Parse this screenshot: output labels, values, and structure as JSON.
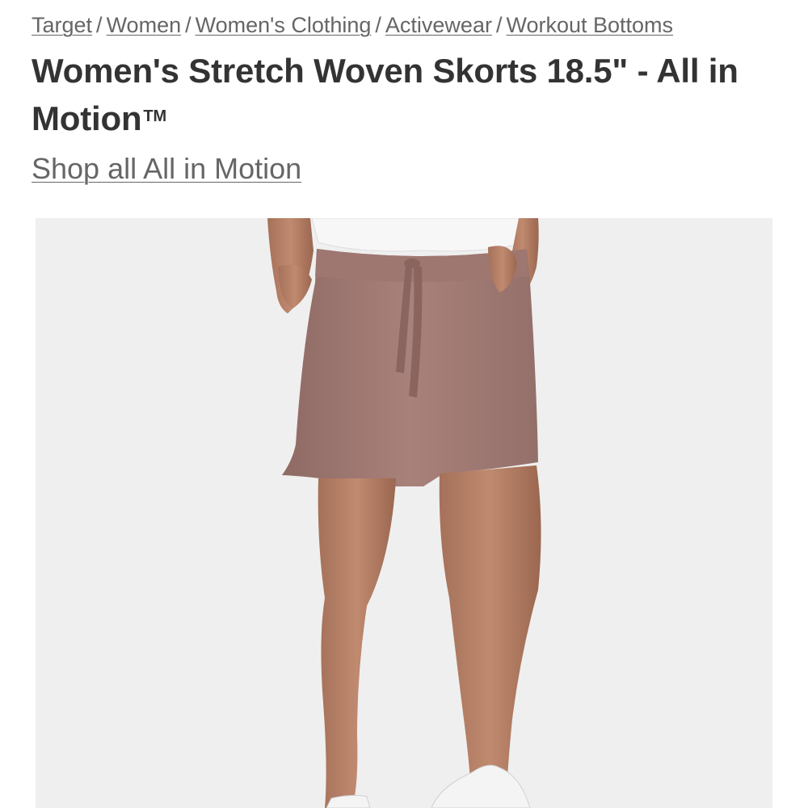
{
  "breadcrumb": {
    "items": [
      "Target",
      "Women",
      "Women's Clothing",
      "Activewear",
      "Workout Bottoms"
    ],
    "separator": "/"
  },
  "product": {
    "title": "Women's Stretch Woven Skorts 18.5\" - All in Motion",
    "trademark": "TM",
    "brand_link": "Shop all All in Motion"
  },
  "colors": {
    "text_primary": "#333333",
    "text_link": "#666666",
    "image_background": "#efefef",
    "skort": "#a27b74"
  },
  "image": {
    "subject": "Model wearing mauve skort with white top and white sneakers"
  }
}
